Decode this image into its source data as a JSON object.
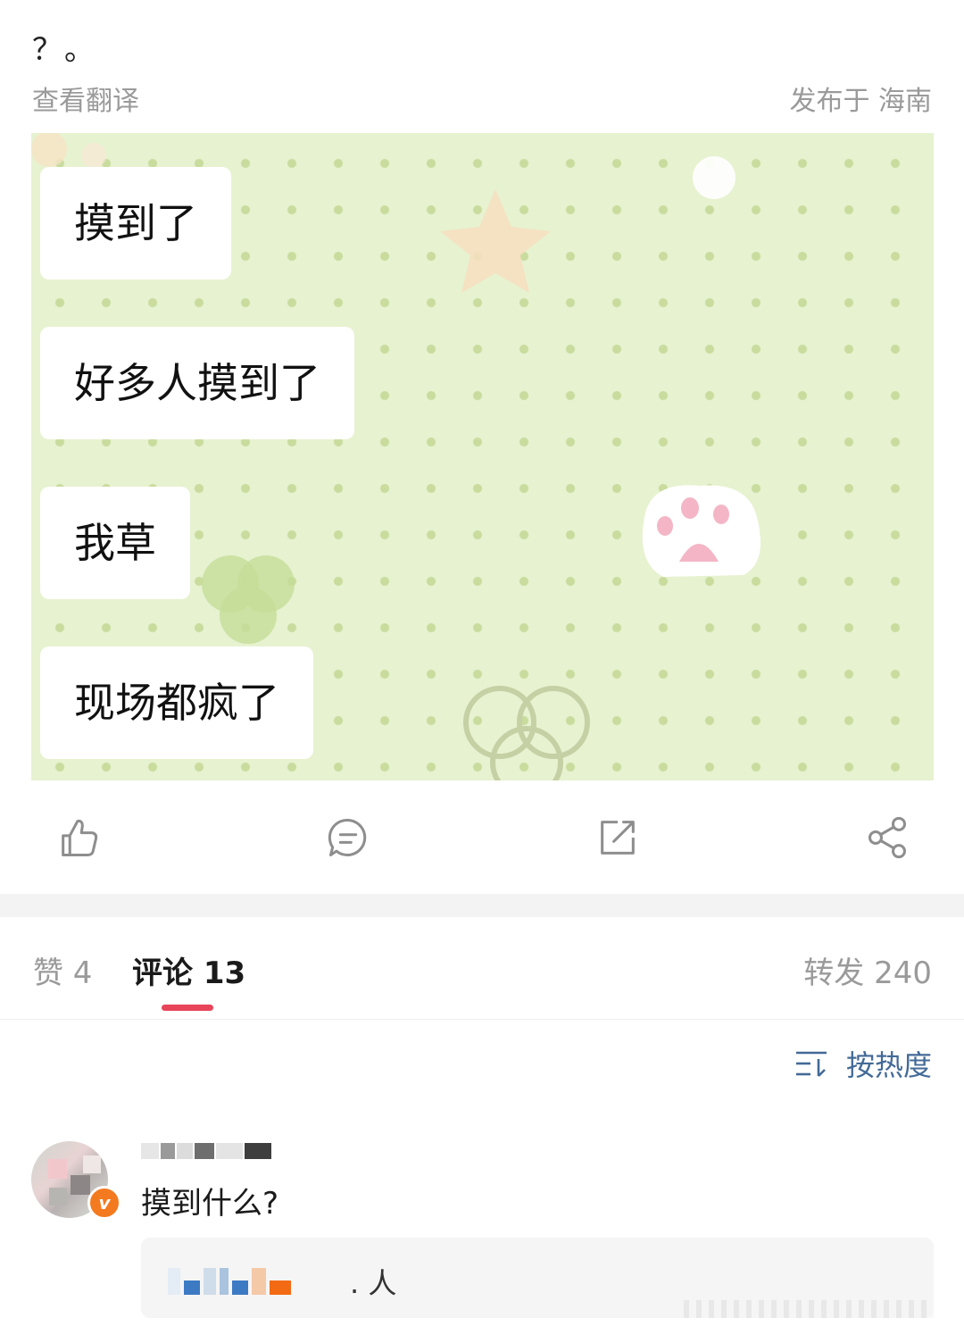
{
  "post": {
    "text": "？。",
    "translate_label": "查看翻译",
    "location": "发布于 海南"
  },
  "image": {
    "bubbles": [
      "摸到了",
      "好多人摸到了",
      "我草",
      "现场都疯了"
    ]
  },
  "actions": {
    "icons": [
      "like-icon",
      "comment-icon",
      "repost-icon",
      "share-icon"
    ]
  },
  "tabs": {
    "likes": "赞 4",
    "comments": "评论 13",
    "reposts": "转发 240"
  },
  "sort": {
    "label": "按热度",
    "icon": "sort-icon"
  },
  "comment": {
    "text": "摸到什么?",
    "badge": "v",
    "reply_suffix": ". 人"
  },
  "colors": {
    "accent_underline": "#e8445a",
    "link_blue": "#436a97",
    "verified_orange": "#f47a20"
  }
}
